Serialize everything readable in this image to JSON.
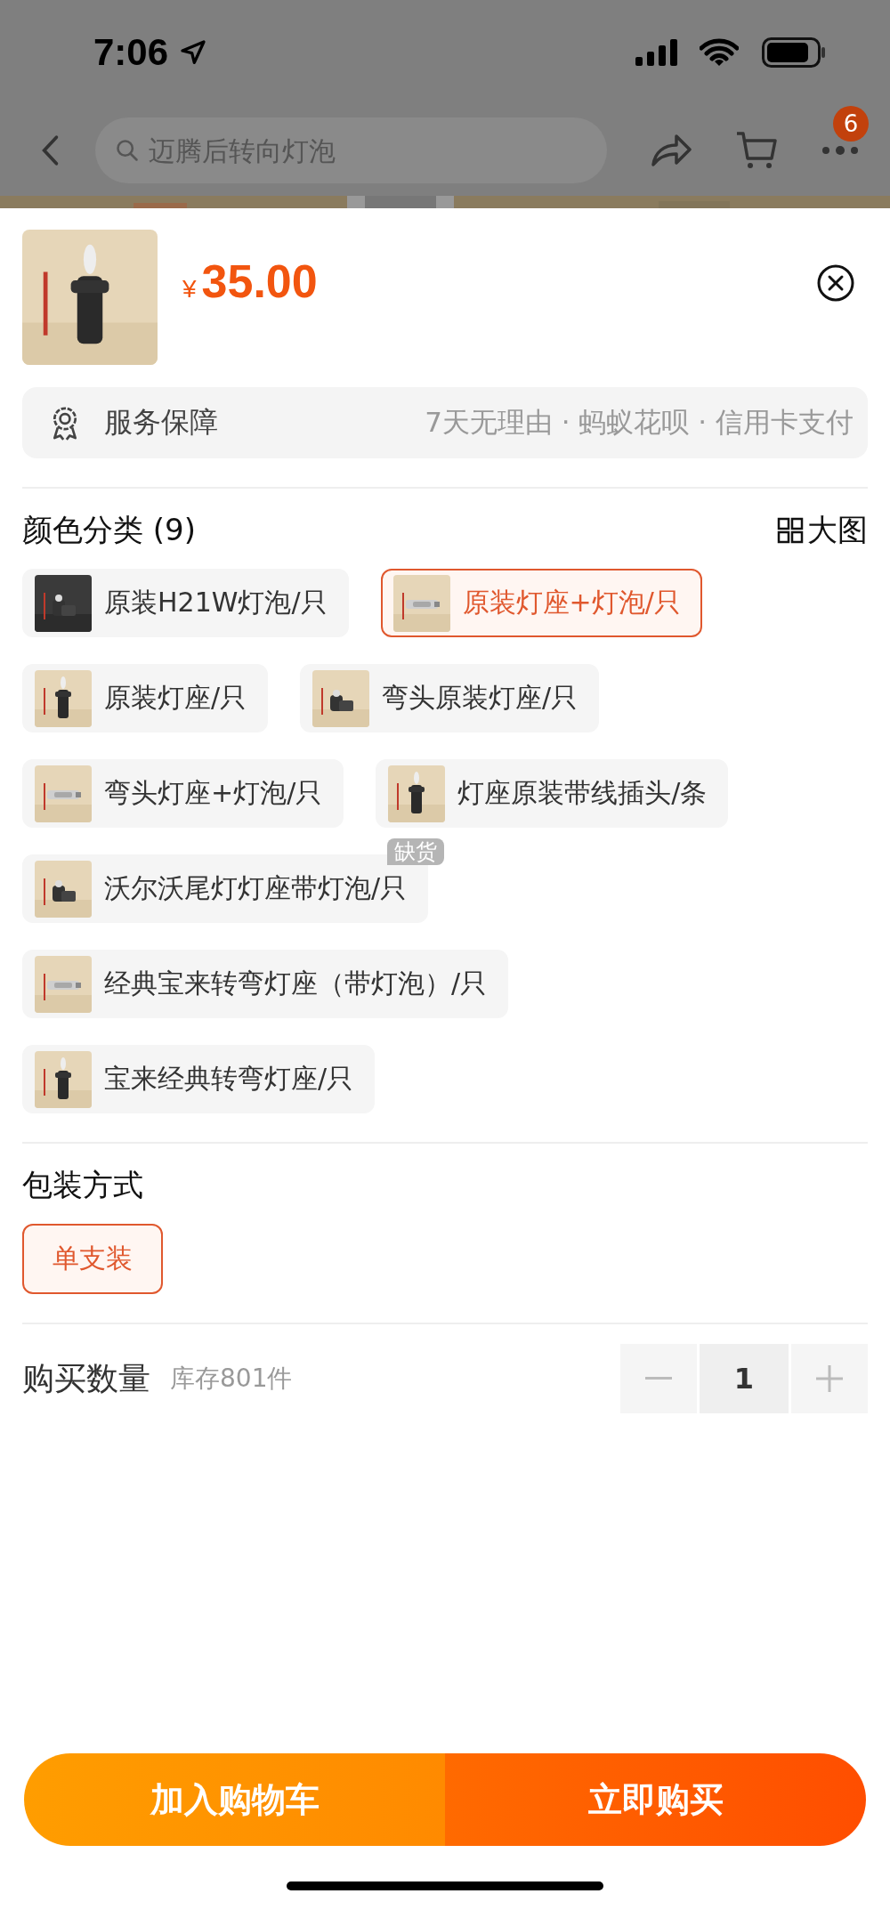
{
  "status_bar": {
    "time": "7:06"
  },
  "nav": {
    "search": {
      "placeholder": "迈腾后转向灯泡"
    },
    "more_badge": "6"
  },
  "product": {
    "currency": "¥",
    "price": "35.00"
  },
  "service": {
    "label": "服务保障",
    "details": "7天无理由 · 蚂蚁花呗 · 信用卡支付"
  },
  "variants": {
    "title": "颜色分类 (9)",
    "view_toggle": "大图",
    "options": [
      {
        "label": "原装H21W灯泡/只",
        "selected": false,
        "sold_out": false
      },
      {
        "label": "原装灯座+灯泡/只",
        "selected": true,
        "sold_out": false
      },
      {
        "label": "原装灯座/只",
        "selected": false,
        "sold_out": false
      },
      {
        "label": "弯头原装灯座/只",
        "selected": false,
        "sold_out": false
      },
      {
        "label": "弯头灯座+灯泡/只",
        "selected": false,
        "sold_out": false
      },
      {
        "label": "灯座原装带线插头/条",
        "selected": false,
        "sold_out": false
      },
      {
        "label": "沃尔沃尾灯灯座带灯泡/只",
        "selected": false,
        "sold_out": true,
        "badge": "缺货"
      },
      {
        "label": "经典宝来转弯灯座（带灯泡）/只",
        "selected": false,
        "sold_out": false
      },
      {
        "label": "宝来经典转弯灯座/只",
        "selected": false,
        "sold_out": false
      }
    ]
  },
  "packaging": {
    "title": "包装方式",
    "options": [
      {
        "label": "单支装",
        "selected": true
      }
    ]
  },
  "quantity": {
    "label": "购买数量",
    "stock": "库存801件",
    "value": "1"
  },
  "actions": {
    "add_to_cart": "加入购物车",
    "buy_now": "立即购买"
  }
}
